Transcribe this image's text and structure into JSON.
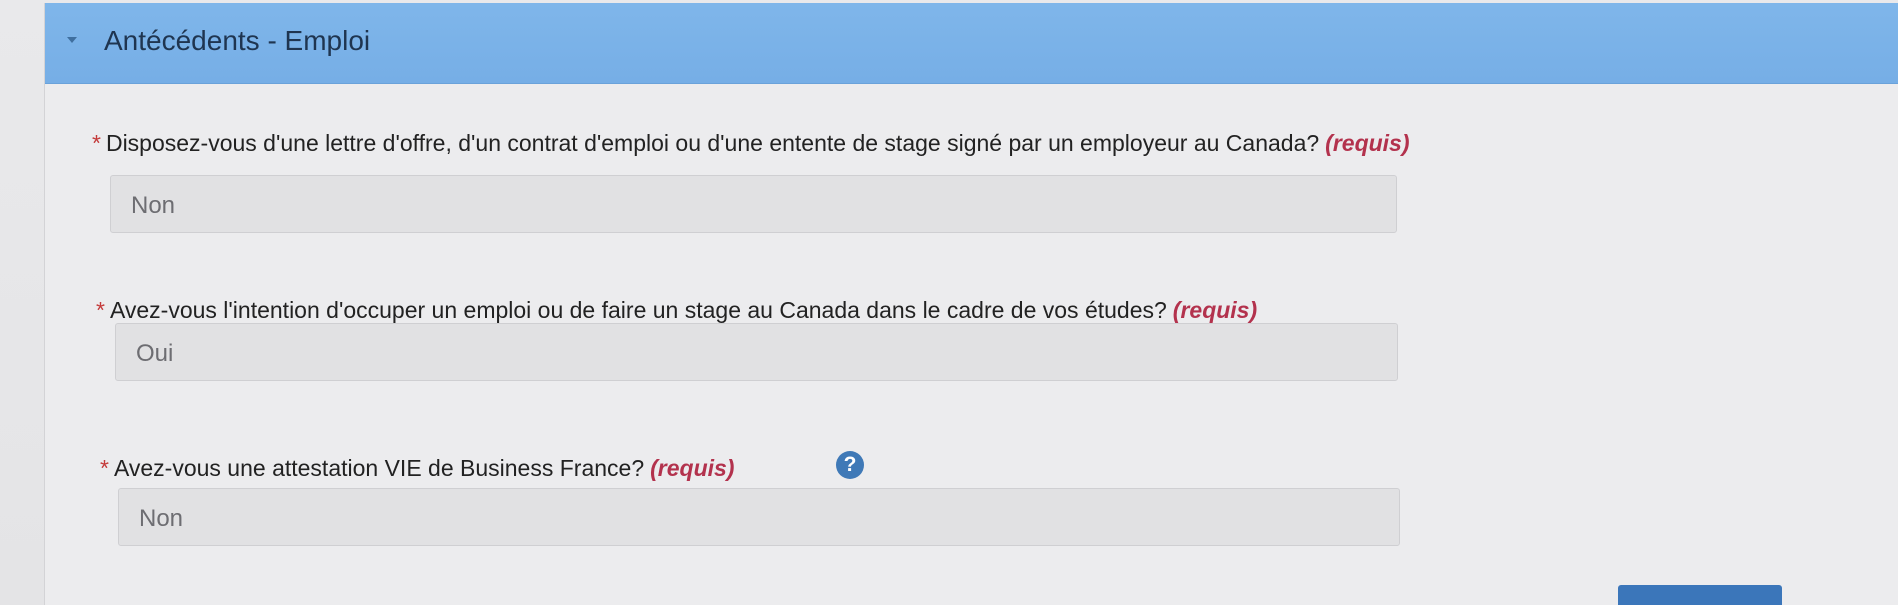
{
  "panel": {
    "title": "Antécédents - Emploi"
  },
  "questions": [
    {
      "required_marker": "*",
      "label": "Disposez-vous d'une lettre d'offre, d'un contrat d'emploi ou d'une entente de stage signé par un employeur au Canada?",
      "required_text": "(requis)",
      "value": "Non"
    },
    {
      "required_marker": "*",
      "label": "Avez-vous l'intention d'occuper un emploi ou de faire un stage au Canada dans le cadre de vos études?",
      "required_text": "(requis)",
      "value": "Oui"
    },
    {
      "required_marker": "*",
      "label": "Avez-vous une attestation VIE de Business France?",
      "required_text": "(requis)",
      "value": "Non",
      "help_icon": "question-mark-circle"
    }
  ],
  "help_icon_symbol": "?"
}
